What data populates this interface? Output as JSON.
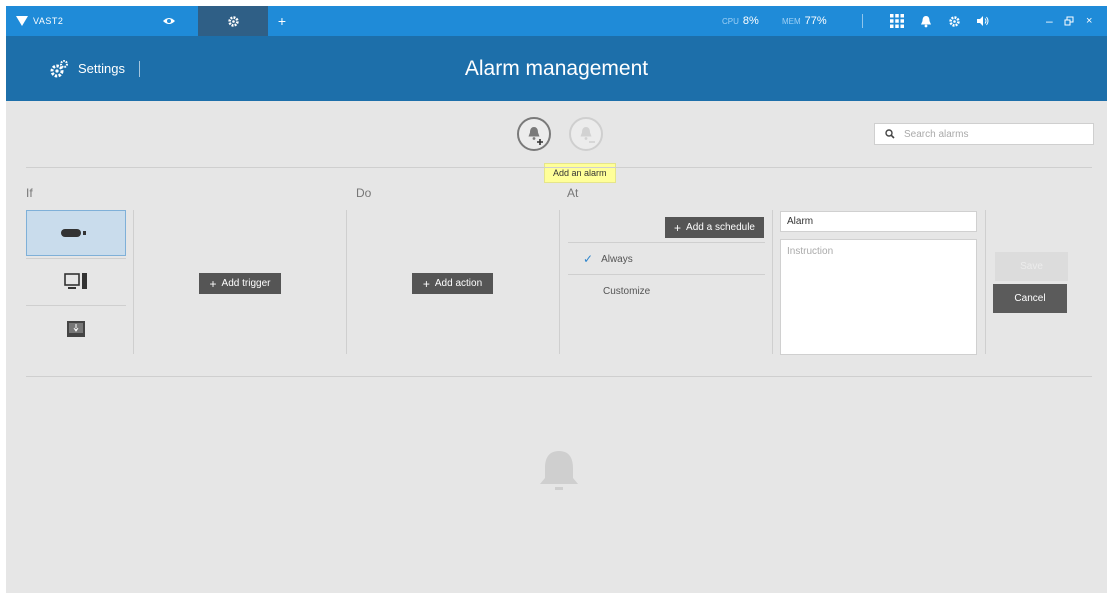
{
  "app": {
    "name": "VAST2",
    "tabs": [
      {
        "icon": "eye-icon"
      },
      {
        "icon": "gear-icon",
        "active": true
      },
      {
        "icon": "plus-icon"
      }
    ],
    "stats": {
      "cpu_label": "CPU",
      "cpu_value": "8%",
      "mem_label": "MEM",
      "mem_value": "77%"
    },
    "toolbar_icons": [
      "grid-icon",
      "bell-icon",
      "gear-icon",
      "speaker-icon"
    ],
    "window_controls": [
      "minimize-icon",
      "restore-icon",
      "close-icon"
    ]
  },
  "header": {
    "settings_label": "Settings",
    "title": "Alarm management"
  },
  "toolbar": {
    "add_tooltip": "Add an alarm",
    "search_placeholder": "Search alarms"
  },
  "columns": {
    "if_label": "If",
    "do_label": "Do",
    "at_label": "At"
  },
  "triggers": [
    {
      "icon": "camera-icon",
      "selected": true
    },
    {
      "icon": "computer-icon"
    },
    {
      "icon": "nas-icon"
    }
  ],
  "buttons": {
    "add_trigger": "Add trigger",
    "add_action": "Add action",
    "add_schedule": "Add a schedule",
    "save": "Save",
    "cancel": "Cancel"
  },
  "schedule": {
    "always": "Always",
    "customize": "Customize"
  },
  "alarm_form": {
    "name_value": "Alarm",
    "instruction_placeholder": "Instruction"
  },
  "colors": {
    "topbar": "#1f8bd8",
    "header": "#1d6faa",
    "background": "#e6e6e6",
    "accent": "#2f86cc",
    "tooltip": "#ffff99"
  }
}
